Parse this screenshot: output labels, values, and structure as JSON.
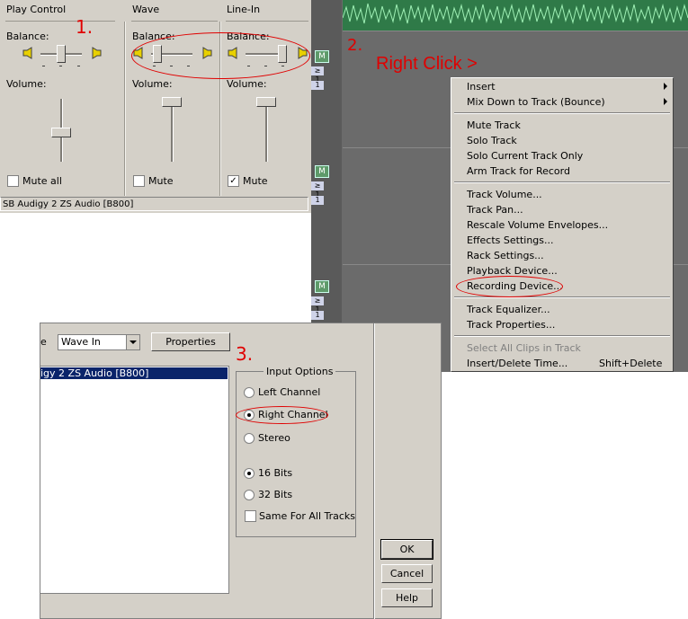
{
  "mixer": {
    "columns": [
      {
        "title": "Play Control",
        "balance_label": "Balance:",
        "volume_label": "Volume:",
        "mute_label": "Mute all",
        "mute_checked": false
      },
      {
        "title": "Wave",
        "balance_label": "Balance:",
        "volume_label": "Volume:",
        "mute_label": "Mute",
        "mute_checked": false
      },
      {
        "title": "Line-In",
        "balance_label": "Balance:",
        "volume_label": "Volume:",
        "mute_label": "Mute",
        "mute_checked": true
      }
    ],
    "status": "SB Audigy 2 ZS Audio [B800]"
  },
  "annotations": {
    "step1": "1.",
    "step2": "2.",
    "step3": "3.",
    "right_click": "Right Click >"
  },
  "daw": {
    "mute_button": "M",
    "strip_labels": [
      "≥ 1",
      "1",
      "≥ 1",
      "1",
      "≥ 1",
      "1"
    ]
  },
  "context_menu": {
    "items": [
      {
        "label": "Insert",
        "submenu": true
      },
      {
        "label": "Mix Down to Track (Bounce)",
        "submenu": true
      },
      {
        "label": "Mute Track"
      },
      {
        "label": "Solo Track"
      },
      {
        "label": "Solo Current Track Only"
      },
      {
        "label": "Arm Track for Record"
      },
      {
        "label": "Track Volume..."
      },
      {
        "label": "Track Pan..."
      },
      {
        "label": "Rescale Volume Envelopes..."
      },
      {
        "label": "Effects Settings..."
      },
      {
        "label": "Rack Settings..."
      },
      {
        "label": "Playback Device..."
      },
      {
        "label": "Recording Device..."
      },
      {
        "label": "Track Equalizer..."
      },
      {
        "label": "Track Properties..."
      },
      {
        "label": "Select All Clips in Track",
        "disabled": true
      },
      {
        "label": "Insert/Delete Time..."
      }
    ],
    "shortcut": "Shift+Delete"
  },
  "dialog": {
    "type_label_fragment": "e",
    "device_type": "Wave In",
    "properties_button": "Properties",
    "device_list": [
      "igy 2 ZS Audio [B800]"
    ],
    "input_options_title": "Input Options",
    "channel_options": [
      "Left Channel",
      "Right Channel",
      "Stereo"
    ],
    "channel_selected": "Right Channel",
    "bit_options": [
      "16 Bits",
      "32 Bits"
    ],
    "bits_selected": "16 Bits",
    "same_for_all_tracks": "Same For All Tracks",
    "same_for_all_checked": false,
    "ok": "OK",
    "cancel": "Cancel",
    "help": "Help"
  }
}
